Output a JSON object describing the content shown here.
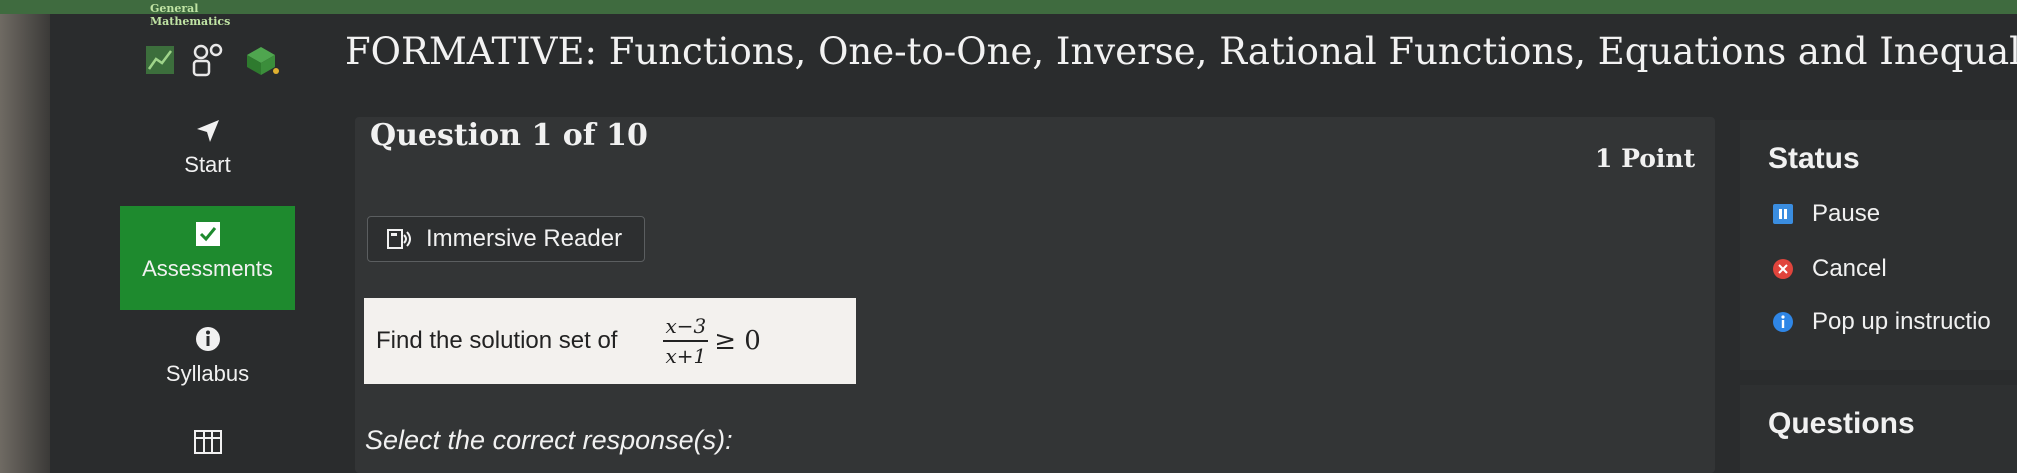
{
  "brand": {
    "line1": "General",
    "line2": "Mathematics"
  },
  "page": {
    "title": "FORMATIVE: Functions, One-to-One, Inverse, Rational Functions, Equations and Inequalities"
  },
  "nav": {
    "start": "Start",
    "assessments": "Assessments",
    "syllabus": "Syllabus"
  },
  "question": {
    "count": "Question 1 of 10",
    "points": "1 Point",
    "immersive_reader": "Immersive Reader",
    "prompt": "Find the solution set of",
    "numerator": "x−3",
    "denominator": "x+1",
    "relation": "≥ 0",
    "instruction": "Select the correct response(s):"
  },
  "status": {
    "title": "Status",
    "pause": "Pause",
    "cancel": "Cancel",
    "popup": "Pop up instructio"
  },
  "questions": {
    "title": "Questions"
  },
  "colors": {
    "accent_green": "#1e8a2e",
    "pause_blue": "#3a8de0",
    "cancel_red": "#e0443c",
    "info_blue": "#2f86e6"
  }
}
